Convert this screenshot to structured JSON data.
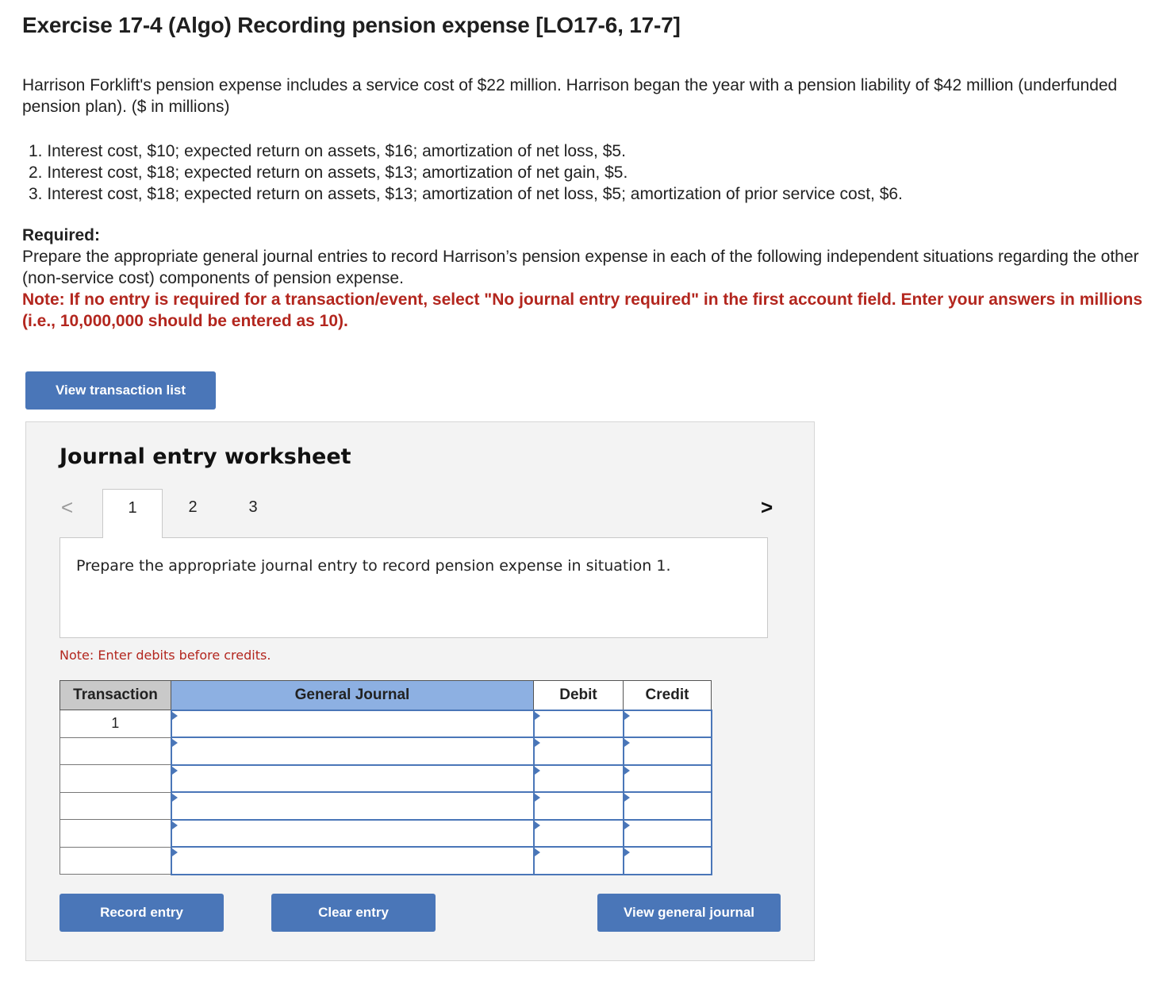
{
  "exercise": {
    "title": "Exercise 17-4 (Algo) Recording pension expense [LO17-6, 17-7]",
    "intro": "Harrison Forklift's pension expense includes a service cost of $22 million. Harrison began the year with a pension liability of $42 million (underfunded pension plan). ($ in millions)",
    "situations": [
      "1. Interest cost, $10; expected return on assets, $16; amortization of net loss, $5.",
      "2. Interest cost, $18; expected return on assets, $13; amortization of net gain, $5.",
      "3. Interest cost, $18; expected return on assets, $13; amortization of net loss, $5; amortization of prior service cost, $6."
    ],
    "required_heading": "Required:",
    "required_text": "Prepare the appropriate general journal entries to record Harrison’s pension expense in each of the following independent situations regarding the other (non-service cost) components of pension expense.",
    "note": "Note: If no entry is required for a transaction/event, select \"No journal entry required\" in the first account field. Enter your answers in millions (i.e., 10,000,000 should be entered as 10)."
  },
  "buttons": {
    "view_transactions": "View transaction list",
    "record": "Record entry",
    "clear": "Clear entry",
    "view_journal": "View general journal"
  },
  "worksheet": {
    "title": "Journal entry worksheet",
    "prev_icon": "<",
    "next_icon": ">",
    "tabs": [
      "1",
      "2",
      "3"
    ],
    "active_tab": "1",
    "prompt": "Prepare the appropriate journal entry to record pension expense in situation 1.",
    "debit_note": "Note: Enter debits before credits.",
    "table": {
      "headers": [
        "Transaction",
        "General Journal",
        "Debit",
        "Credit"
      ],
      "rows": [
        {
          "transaction": "1",
          "account": "",
          "debit": "",
          "credit": ""
        },
        {
          "transaction": "",
          "account": "",
          "debit": "",
          "credit": ""
        },
        {
          "transaction": "",
          "account": "",
          "debit": "",
          "credit": ""
        },
        {
          "transaction": "",
          "account": "",
          "debit": "",
          "credit": ""
        },
        {
          "transaction": "",
          "account": "",
          "debit": "",
          "credit": ""
        },
        {
          "transaction": "",
          "account": "",
          "debit": "",
          "credit": ""
        }
      ]
    }
  },
  "colors": {
    "button_blue": "#4a76b8",
    "note_red": "#b3261e",
    "gj_header_blue": "#8db0e2",
    "worksheet_bg": "#f3f3f3"
  }
}
